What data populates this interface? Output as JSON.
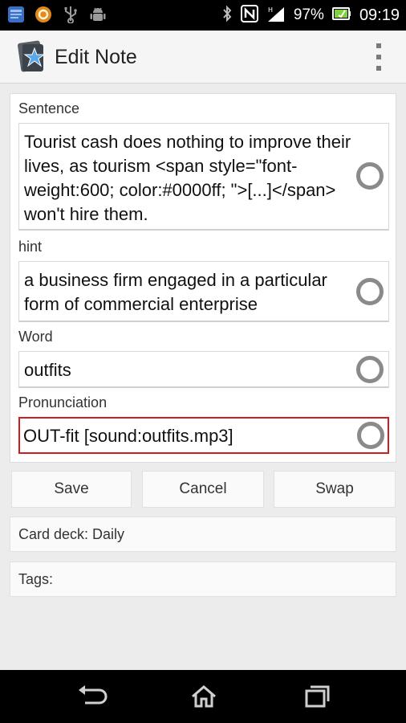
{
  "status_bar": {
    "battery": "97%",
    "time": "09:19",
    "icons": [
      "news-app-icon",
      "orange-circle-app-icon",
      "usb-icon",
      "android-debug-icon",
      "bluetooth-icon",
      "nfc-icon",
      "signal-icon",
      "battery-icon"
    ]
  },
  "action_bar": {
    "title": "Edit Note",
    "logo": "anki-star-logo",
    "overflow": "overflow-menu-icon"
  },
  "fields": [
    {
      "label": "Sentence",
      "value": "Tourist cash does nothing to improve their lives, as tourism <span style=\"font-weight:600; color:#0000ff; \">[...]</span> won't hire them."
    },
    {
      "label": "hint",
      "value": "a business firm engaged in a particular form of commercial enterprise"
    },
    {
      "label": "Word",
      "value": "outfits"
    },
    {
      "label": "Pronunciation",
      "value": "OUT-fit [sound:outfits.mp3]"
    }
  ],
  "buttons": {
    "save": "Save",
    "cancel": "Cancel",
    "swap": "Swap"
  },
  "card_deck": "Card deck: Daily",
  "tags": "Tags:",
  "colors": {
    "active_border": "#cc1e1e",
    "circle_button": "#8a8a8a",
    "status_bar_bg": "#000000",
    "nav_bar_bg": "#000000"
  },
  "nav_bar": [
    "back-icon",
    "home-icon",
    "recent-apps-icon"
  ]
}
